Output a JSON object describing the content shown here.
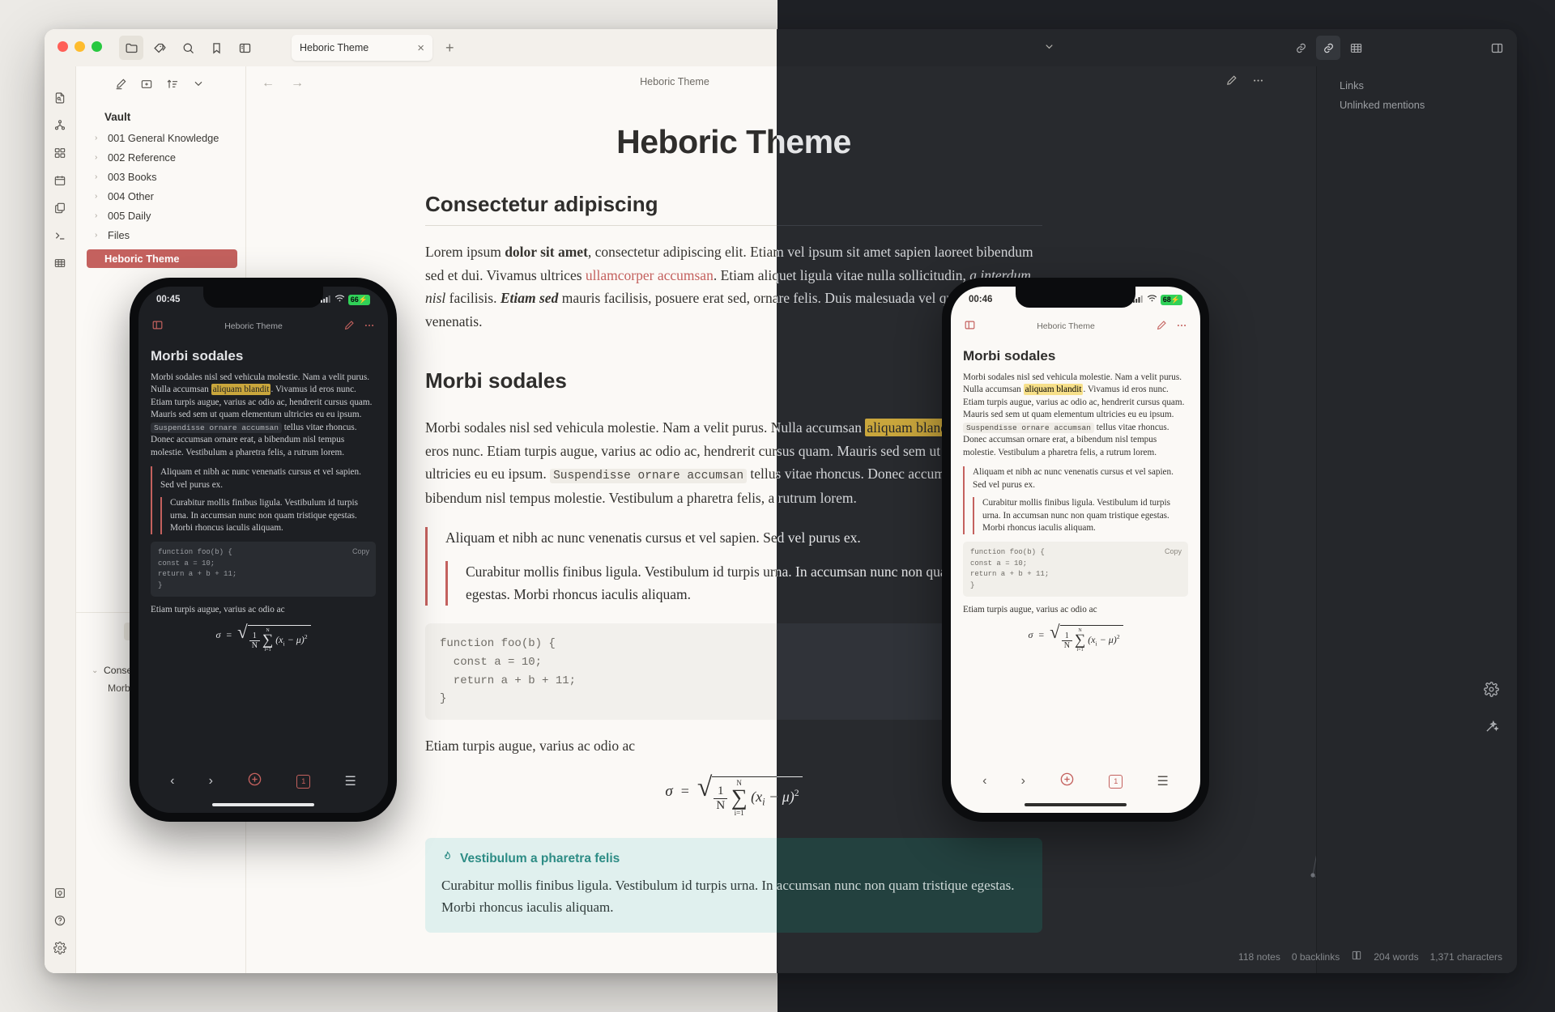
{
  "window": {
    "traffic_lights": [
      "close",
      "minimize",
      "maximize"
    ],
    "toolbar_icons": [
      "folder-icon",
      "tag-icon",
      "search-icon",
      "bookmark-icon",
      "sidebar-toggle-icon"
    ],
    "tab": {
      "title": "Heboric Theme",
      "close_label": "×",
      "new_tab_label": "+"
    },
    "right_toolbar_icons": [
      "link-icon",
      "backlink-icon",
      "table-icon",
      "right-sidebar-icon"
    ],
    "chevron_label": "⌄"
  },
  "ribbon": {
    "items": [
      {
        "name": "quick-switcher-icon"
      },
      {
        "name": "graph-view-icon"
      },
      {
        "name": "canvas-icon"
      },
      {
        "name": "calendar-icon"
      },
      {
        "name": "copy-icon"
      },
      {
        "name": "terminal-icon"
      },
      {
        "name": "table-icon"
      }
    ],
    "bottom_items": [
      {
        "name": "vault-icon"
      },
      {
        "name": "help-icon"
      },
      {
        "name": "settings-icon"
      }
    ]
  },
  "explorer": {
    "tools": [
      "new-note-icon",
      "new-folder-icon",
      "sort-icon",
      "collapse-icon"
    ],
    "vault_label": "Vault",
    "folders": [
      {
        "label": "001 General Knowledge"
      },
      {
        "label": "002 Reference"
      },
      {
        "label": "003 Books"
      },
      {
        "label": "004 Other"
      },
      {
        "label": "005 Daily"
      },
      {
        "label": "Files"
      }
    ],
    "active_file": "Heboric Theme"
  },
  "outline": {
    "items": [
      {
        "label": "Consectetur adipiscing",
        "level": 1
      },
      {
        "label": "Morbi sodales",
        "level": 2
      }
    ]
  },
  "view_header": {
    "title": "Heboric Theme",
    "back_label": "←",
    "forward_label": "→",
    "edit_icon": "pencil-icon",
    "more_icon": "more-options-icon"
  },
  "right_panel": {
    "items": [
      {
        "label": "Links"
      },
      {
        "label": "Unlinked mentions"
      }
    ]
  },
  "status_bar": {
    "notes": "118 notes",
    "backlinks": "0 backlinks",
    "book_icon": "book-icon",
    "words": "204 words",
    "characters": "1,371 characters"
  },
  "side_icons": [
    "settings-gear-icon",
    "magic-wand-icon"
  ],
  "document": {
    "h1": "Heboric Theme",
    "h2_first": "Consectetur adipiscing",
    "p1_a": "Lorem ipsum ",
    "p1_bold": "dolor sit amet",
    "p1_b": ", consectetur adipiscing elit. Etiam vel ipsum sit amet sapien laoreet bibendum sed et dui. Vivamus ultrices ",
    "p1_link": "ullamcorper accumsan",
    "p1_c": ". Etiam aliquet ligula vitae nulla sollicitudin, ",
    "p1_italic": "a interdum nisl",
    "p1_d": " facilisis. ",
    "p1_bolditalic": "Etiam sed",
    "p1_e": " mauris facilisis, posuere erat sed, ornare felis. Duis malesuada vel quam id venenatis.",
    "h2_second": "Morbi sodales",
    "p2_a": "Morbi sodales nisl sed vehicula molestie. Nam a velit purus. Nulla accumsan ",
    "p2_hl": "aliquam blandit",
    "p2_b": ". Vivamus id eros nunc. Etiam turpis augue, varius ac odio ac, hendrerit cursus quam. Mauris sed sem ut quam elementum ultricies eu eu ipsum. ",
    "p2_code": "Suspendisse ornare accumsan",
    "p2_c": " tellus vitae rhoncus. Donec accumsan ornare erat, a bibendum nisl tempus molestie. Vestibulum a pharetra felis, a rutrum lorem.",
    "bq1": "Aliquam et nibh ac nunc venenatis cursus et vel sapien. Sed vel purus ex.",
    "bq2": "Curabitur mollis finibus ligula. Vestibulum id turpis urna. In accumsan nunc non quam tristique egestas. Morbi rhoncus iaculis aliquam.",
    "code_lines": [
      "function foo(b) {",
      "  const a = 10;",
      "  return a + b + 11;",
      "}"
    ],
    "p3": "Etiam turpis augue, varius ac odio ac",
    "math_sigma": "σ",
    "math_equals": "=",
    "math_num": "1",
    "math_den": "N",
    "math_sum_top": "N",
    "math_sum_bottom": "i=1",
    "math_sum": "∑",
    "math_expr": "(x",
    "math_sub": "i",
    "math_minus": " − μ)",
    "math_pow": "2",
    "callout_icon": "flame-icon",
    "callout_title": "Vestibulum a pharetra felis",
    "callout_body": "Curabitur mollis finibus ligula. Vestibulum id turpis urna. In accumsan nunc non quam tristique egestas. Morbi rhoncus iaculis aliquam.",
    "copy_label": "Copy"
  },
  "phone_dark": {
    "time": "00:45",
    "battery": "66",
    "signal_icon": "cellular-icon",
    "wifi_icon": "wifi-icon",
    "header_title": "Heboric Theme",
    "sidebar_icon": "sidebar-icon",
    "edit_icon": "pencil-icon",
    "more_icon": "more-options-icon",
    "nav": [
      "back-arrow",
      "forward-arrow",
      "add-circle",
      "tabs-count",
      "menu-icon"
    ],
    "tabs_count": "1"
  },
  "phone_light": {
    "time": "00:46",
    "battery": "68",
    "signal_icon": "cellular-icon",
    "wifi_icon": "wifi-icon",
    "header_title": "Heboric Theme",
    "sidebar_icon": "sidebar-icon",
    "edit_icon": "pencil-icon",
    "more_icon": "more-options-icon",
    "nav": [
      "back-arrow",
      "forward-arrow",
      "add-circle",
      "tabs-count",
      "menu-icon"
    ],
    "tabs_count": "1"
  },
  "colors": {
    "accent": "#c4615e",
    "highlight": "#f7e08a",
    "callout_teal": "#2d8c85",
    "light_bg": "#fbf9f6",
    "dark_bg": "#282a2e"
  }
}
